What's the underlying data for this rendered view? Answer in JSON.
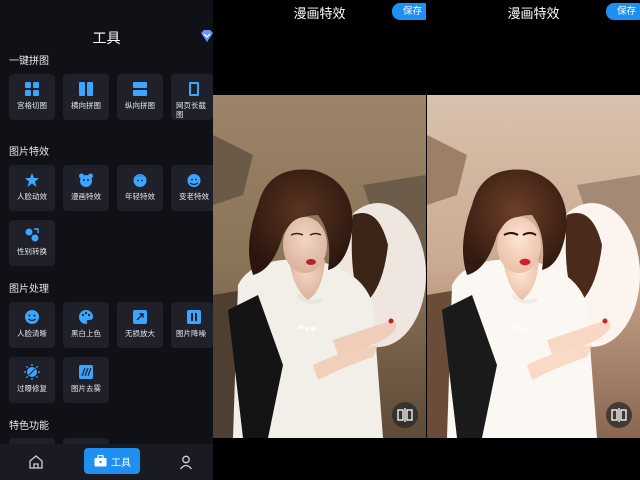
{
  "tools_panel": {
    "title": "工具",
    "sections": [
      {
        "title": "一键拼图",
        "items": [
          "宫格切图",
          "横向拼图",
          "纵向拼图",
          "网页长截图"
        ]
      },
      {
        "title": "图片特效",
        "items": [
          "人脸动效",
          "漫画特效",
          "年轻特效",
          "变老特效",
          "性别转换"
        ]
      },
      {
        "title": "图片处理",
        "items": [
          "人脸清晰",
          "黑白上色",
          "无损放大",
          "图片降噪",
          "过曝修复",
          "图片去雾"
        ]
      },
      {
        "title": "特色功能"
      }
    ],
    "tabbar": {
      "active_label": "工具"
    }
  },
  "effect_screens": [
    {
      "title": "漫画特效",
      "save_label": "保存",
      "variant": "original"
    },
    {
      "title": "漫画特效",
      "save_label": "保存",
      "variant": "comic"
    }
  ],
  "colors": {
    "accent": "#1f8ff2",
    "tile": "#1f2029",
    "icon": "#3aa6ff",
    "panel_bg": "#101117"
  }
}
